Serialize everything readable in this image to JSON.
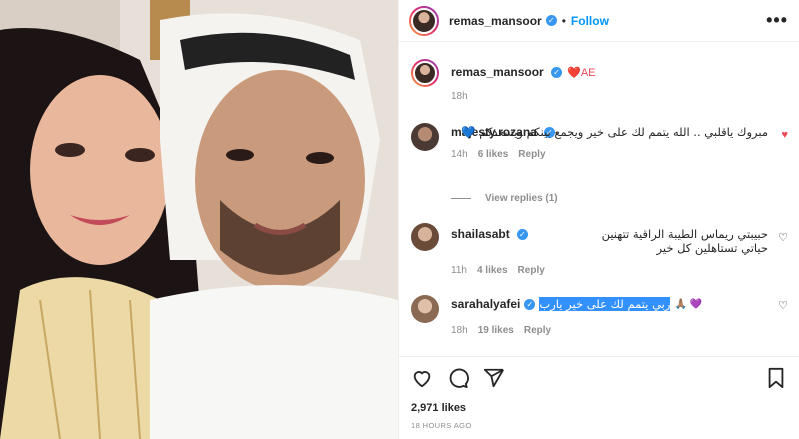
{
  "colors": {
    "accent": "#0095f6",
    "verified": "#3897f0",
    "like_red": "#ed4956",
    "selection": "#3390ff"
  },
  "header": {
    "username": "remas_mansoor",
    "dot": "•",
    "follow_label": "Follow",
    "more_label": "•••"
  },
  "caption": {
    "username": "remas_mansoor",
    "text": "❤️AE",
    "time": "18h"
  },
  "comments": [
    {
      "username": "majesty.rozana",
      "text": "مبروك ياقلبي .. الله يتمم لك على خير ويجمع بينكم ويسعدكم 💙",
      "time": "14h",
      "likes": "6 likes",
      "reply": "Reply",
      "liked": true
    },
    {
      "username": "shailasabt",
      "text": "حبيبتي ريماس الطيبة الراقية تتهنين حياتي تستاهلين كل خير",
      "time": "11h",
      "likes": "4 likes",
      "reply": "Reply",
      "liked": false
    },
    {
      "username": "sarahalyafei",
      "text_highlight": "ربي يتمم لك على خير يارب",
      "text_emoji": "🙏🏽 💜",
      "time": "18h",
      "likes": "19 likes",
      "reply": "Reply",
      "liked": false
    }
  ],
  "view_replies": "View replies (1)",
  "actions": {
    "like_icon": "heart-icon",
    "comment_icon": "comment-icon",
    "share_icon": "share-icon",
    "save_icon": "bookmark-icon"
  },
  "post": {
    "likes": "2,971 likes",
    "time_ago": "18 HOURS AGO"
  }
}
